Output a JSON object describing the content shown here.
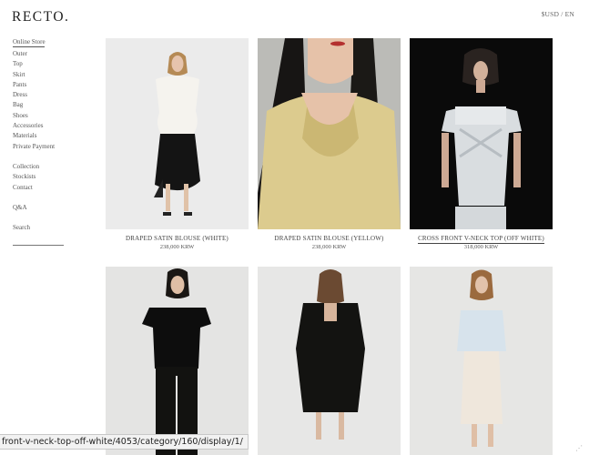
{
  "brand": {
    "logo": "RECTO."
  },
  "header": {
    "currency": "$USD / EN"
  },
  "sidebar": {
    "group1": [
      "Online Store",
      "Outer",
      "Top",
      "Skirt",
      "Pants",
      "Dress",
      "Bag",
      "Shoes",
      "Accessories",
      "Materials",
      "Private Payment"
    ],
    "group2": [
      "Collection",
      "Stockists",
      "Contact"
    ],
    "group3": [
      "Q&A"
    ],
    "search_label": "Search"
  },
  "products": [
    {
      "name": "DRAPED SATIN BLOUSE (WHITE)",
      "price": "238,000 KRW"
    },
    {
      "name": "DRAPED SATIN BLOUSE (YELLOW)",
      "price": "238,000 KRW"
    },
    {
      "name": "CROSS FRONT V-NECK TOP (OFF WHITE)",
      "price": "318,000 KRW"
    },
    {
      "name": "",
      "price": ""
    },
    {
      "name": "",
      "price": ""
    },
    {
      "name": "",
      "price": ""
    }
  ],
  "status_bar": {
    "url": "front-v-neck-top-off-white/4053/category/160/display/1/"
  },
  "colors": {
    "photo_light": "#e9e9e9",
    "photo_dark": "#0d0d0d",
    "photo_yellow": "#d6c98f"
  }
}
